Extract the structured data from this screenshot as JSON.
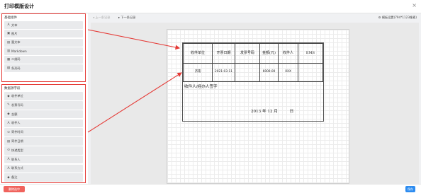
{
  "window": {
    "title": "打印模版设计",
    "close_glyph": "×"
  },
  "sidebar": {
    "basic_group": {
      "title": "基础组件",
      "items": [
        {
          "icon": "text-icon",
          "glyph": "A",
          "label": "文本"
        },
        {
          "icon": "image-icon",
          "glyph": "▣",
          "label": "图片"
        },
        {
          "icon": "rich-text-icon",
          "glyph": "▤",
          "label": "富文本"
        },
        {
          "icon": "markdown-icon",
          "glyph": "▥",
          "label": "Markdown"
        },
        {
          "icon": "qrcode-icon",
          "glyph": "▦",
          "label": "二维码"
        },
        {
          "icon": "barcode-icon",
          "glyph": "▧",
          "label": "条形码"
        }
      ]
    },
    "data_group": {
      "title": "数据源字段",
      "items": [
        {
          "icon": "recipient-unit-icon",
          "glyph": "◆",
          "label": "收件单位"
        },
        {
          "icon": "ticket-number-icon",
          "glyph": "✎",
          "label": "发票号码"
        },
        {
          "icon": "amount-icon",
          "glyph": "◆",
          "label": "金额"
        },
        {
          "icon": "recipient-icon",
          "glyph": "A",
          "label": "收件人"
        },
        {
          "icon": "send-time-icon",
          "glyph": "⊙",
          "label": "寄件时间"
        },
        {
          "icon": "send-date-icon",
          "glyph": "▤",
          "label": "寄件日期"
        },
        {
          "icon": "express-type-icon",
          "glyph": "⊙",
          "label": "快递类型"
        },
        {
          "icon": "contact-icon",
          "glyph": "A",
          "label": "联系人"
        },
        {
          "icon": "contact-method-icon",
          "glyph": "A",
          "label": "联系方式"
        },
        {
          "icon": "remark-icon",
          "glyph": "◆",
          "label": "备注"
        }
      ]
    }
  },
  "toolbar": {
    "prev_label": "◂ 上一条记录",
    "next_label": "▸ 下一条记录",
    "settings_label": "⚙ 模板设置(794*1123像素)"
  },
  "form": {
    "headers": [
      "收件单位",
      "开票日期",
      "发票号码",
      "金额(元)",
      "收件人",
      "EMS"
    ],
    "row": [
      "济南",
      "2021-03-11",
      "",
      "6000.00",
      "XXX",
      ""
    ],
    "signature_label": "收件人/经办人签字",
    "date_text": "2013 年 12 月　　　日"
  },
  "bottom": {
    "delete_label": "删除选中",
    "save_label": "保存"
  },
  "colors": {
    "highlight": "#e53935",
    "primary": "#2d8cf0",
    "danger": "#f0635d"
  }
}
